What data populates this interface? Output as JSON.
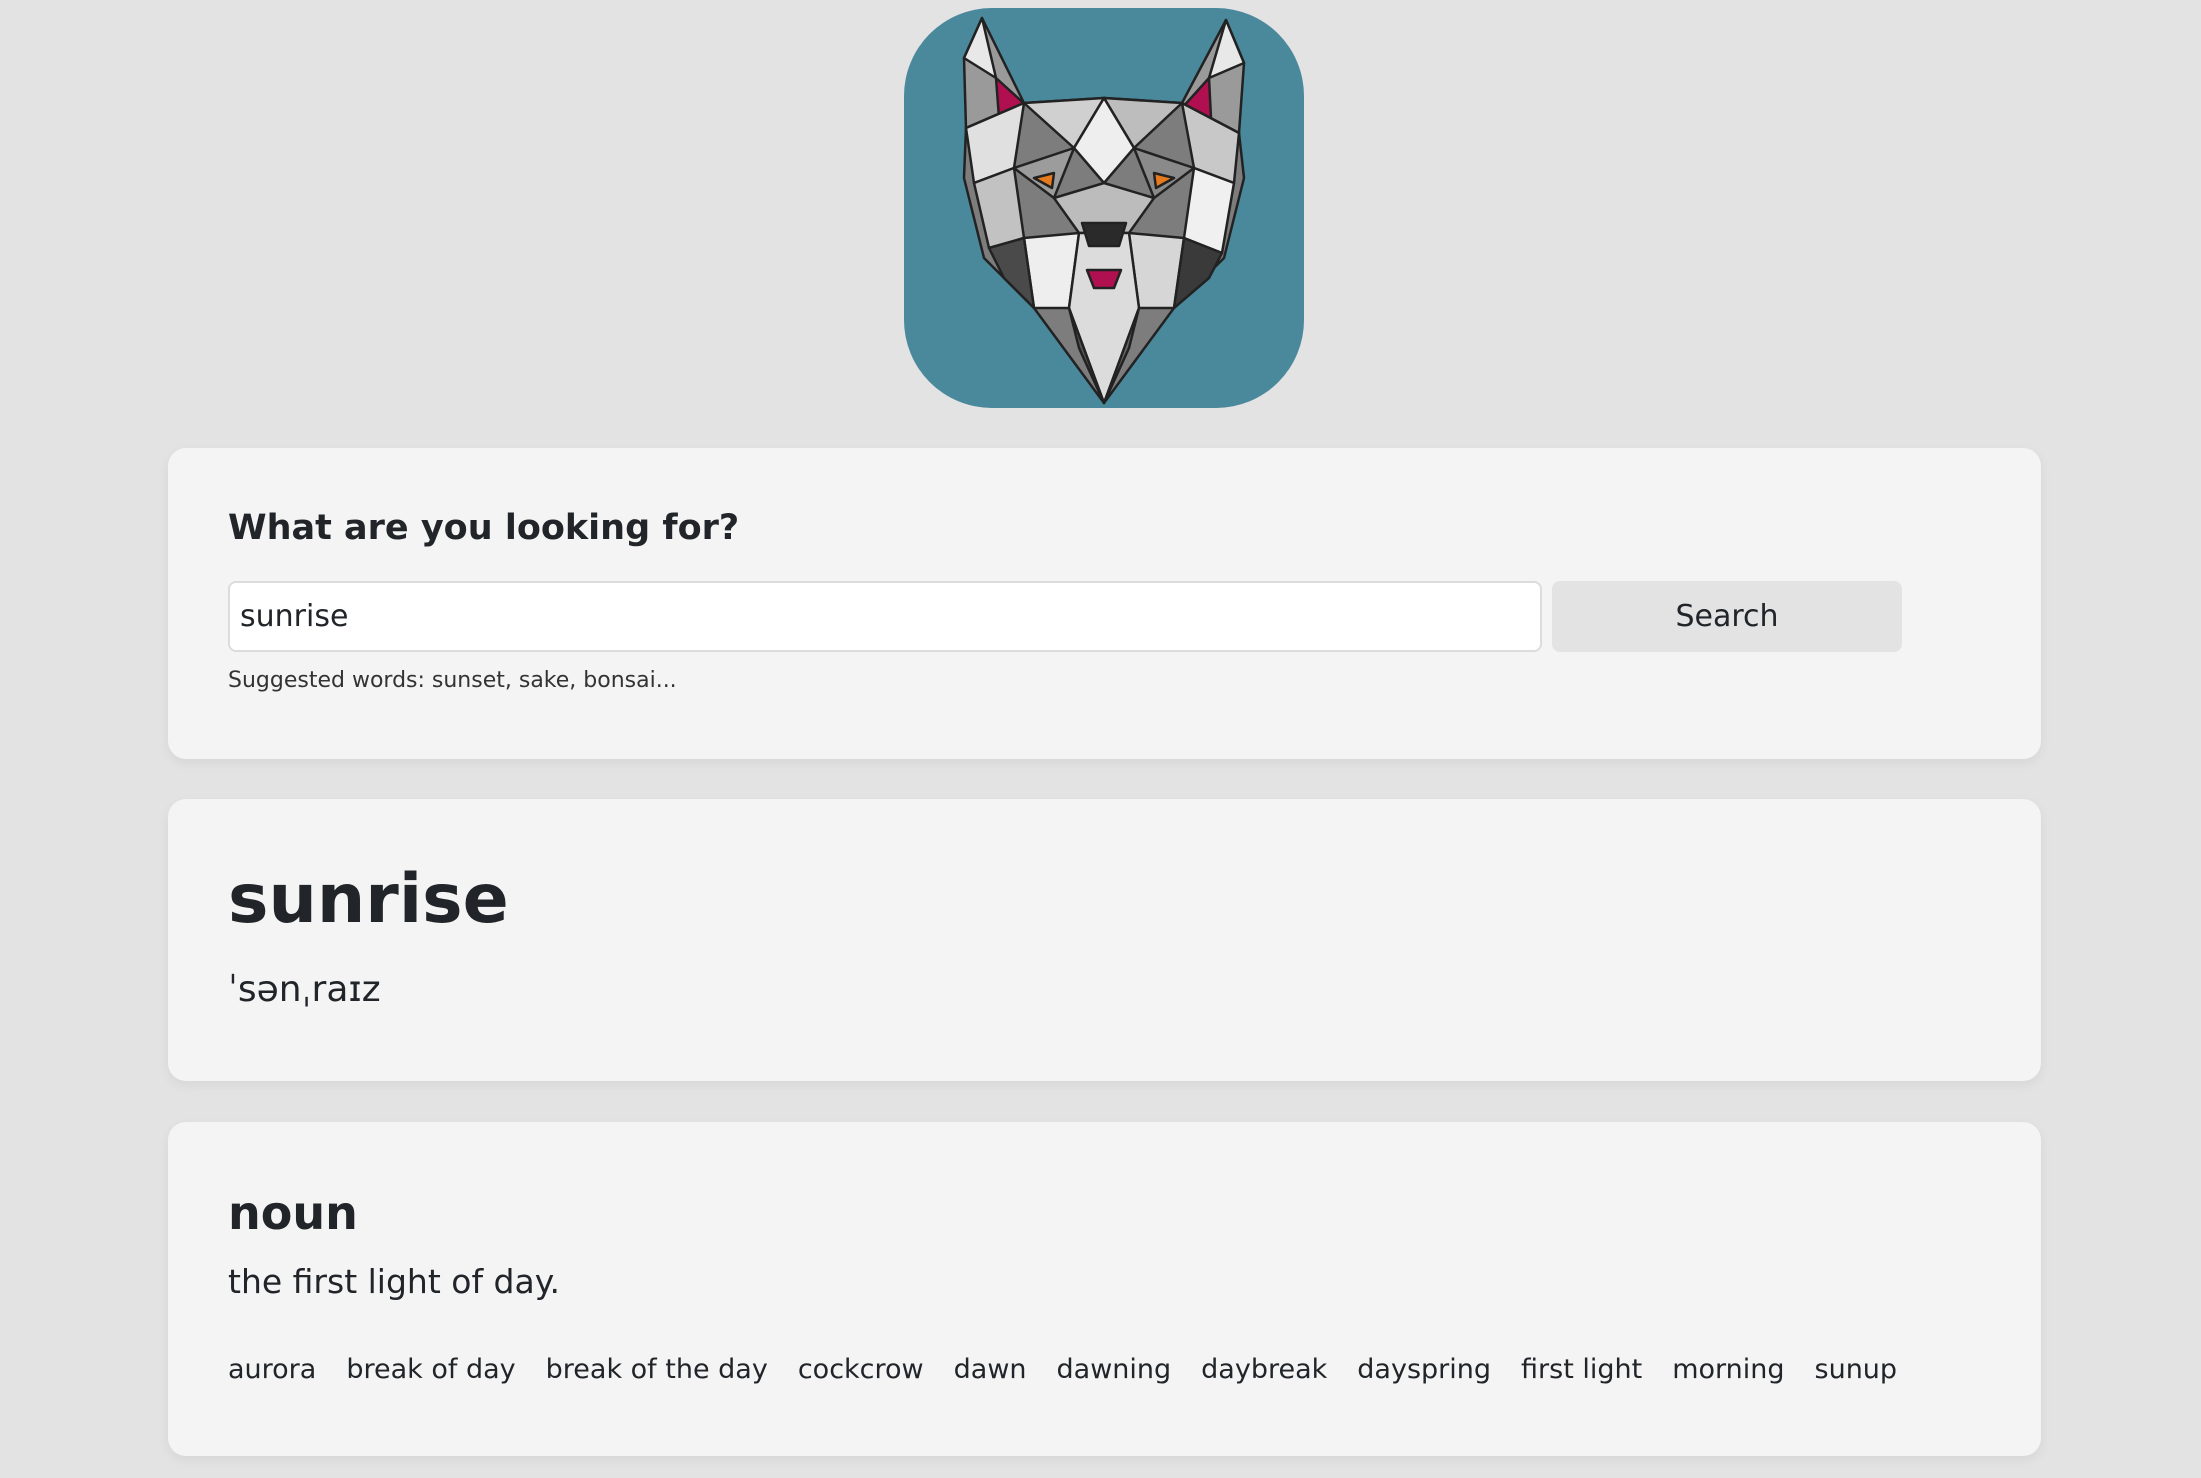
{
  "logo": {
    "background": "#4a889c",
    "icon": "wolf-head-icon"
  },
  "search": {
    "heading": "What are you looking for?",
    "input_value": "sunrise",
    "button_label": "Search",
    "hint": "Suggested words: sunset, sake, bonsai..."
  },
  "result": {
    "word": "sunrise",
    "phonetic": "ˈsənˌraɪz"
  },
  "meaning": {
    "part_of_speech": "noun",
    "definition": "the first light of day.",
    "synonyms": [
      "aurora",
      "break of day",
      "break of the day",
      "cockcrow",
      "dawn",
      "dawning",
      "daybreak",
      "dayspring",
      "first light",
      "morning",
      "sunup"
    ]
  },
  "colors": {
    "page_background": "#e3e3e3",
    "card_background": "#f4f4f4",
    "button_background": "#e3e3e3",
    "text": "#212529",
    "logo_ears": "#b0104f"
  }
}
